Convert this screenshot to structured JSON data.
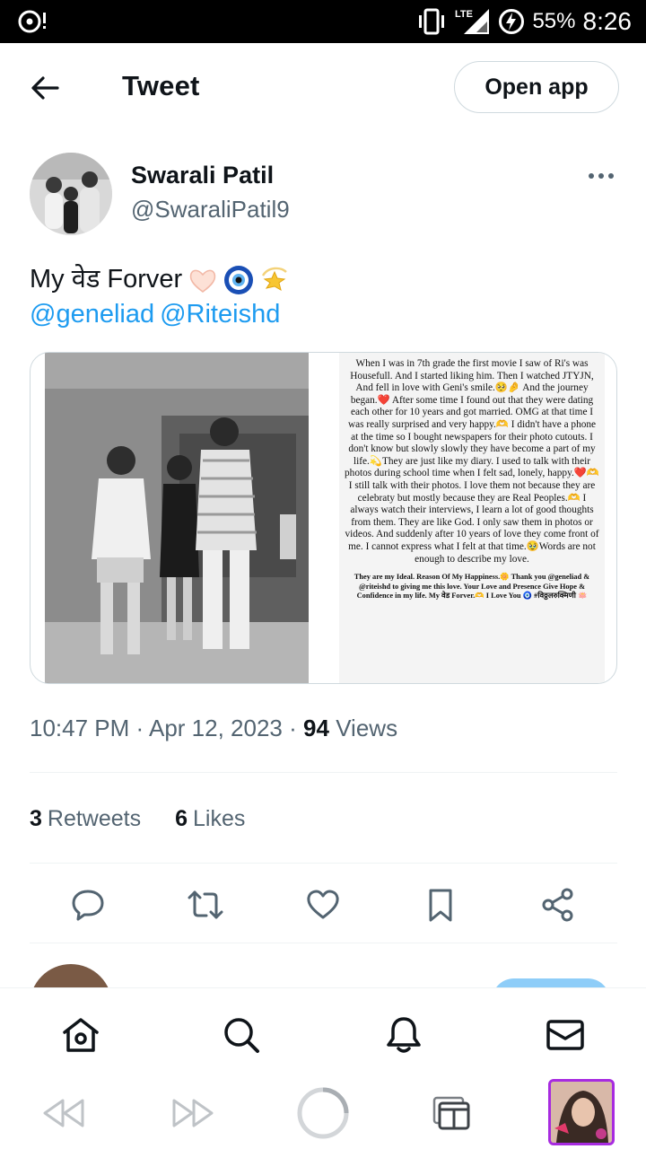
{
  "status_bar": {
    "network": "LTE",
    "battery": "55%",
    "time": "8:26"
  },
  "header": {
    "title": "Tweet",
    "open_app_label": "Open app"
  },
  "tweet": {
    "display_name": "Swarali Patil",
    "handle": "@SwaraliPatil9",
    "text_line1": "My वेड Forver",
    "mention1": "@geneliad",
    "mention2": "@Riteishd",
    "emojis": [
      "heart-hands-emoji",
      "nazar-amulet-emoji",
      "dizzy-emoji"
    ],
    "note_text": "When I was in 7th grade the first movie I saw of Ri's was Housefull. And I started liking him. Then I watched JTYJN, And fell in love with Geni's smile.🥺🤌 And the journey began.❤️ After some time I found out that they were dating each other for 10 years and got married. OMG at that time I was really surprised and very happy.🫶 I didn't have a phone at the time so I bought newspapers for their photo cutouts. I don't know but slowly slowly they have become a part of my life.💫They are just like my diary. I used to talk with their photos during school time when I felt sad, lonely, happy.❤️🫶 I still talk with their photos. I love them not because they are celebraty but mostly because they are Real Peoples.🫶 I always watch their interviews, I learn a lot of good thoughts from them. They are like God. I only saw them in photos or videos. And suddenly after 10 years of love they come front of me. I cannot express what I felt at that time.🥹Words are not enough to describe my love.",
    "note_footer": "They are my Ideal. Reason Of My Happiness.🌼 Thank you @geneliad & @riteishd to giving me this love. Your Love and Presence Give Hope & Confidence in my life. My वेड Forver.🫶 I Love You 🧿 #विठ्ठलरुक्मिणी 🪷",
    "time": "10:47 PM",
    "date": "Apr 12, 2023",
    "views_count": "94",
    "views_label": "Views",
    "retweets_count": "3",
    "retweets_label": "Retweets",
    "likes_count": "6",
    "likes_label": "Likes",
    "separator": "·"
  },
  "colors": {
    "accent": "#1d9bf0",
    "secondary_text": "#536471",
    "border": "#cfd9de"
  }
}
